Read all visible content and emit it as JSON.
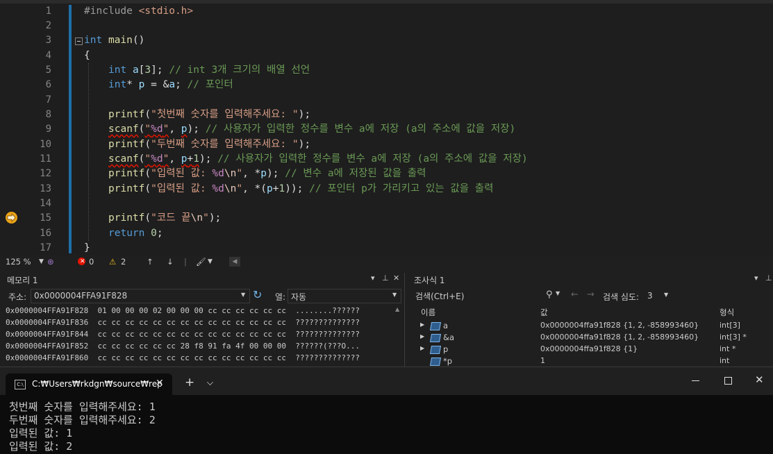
{
  "editor": {
    "line_numbers": [
      "1",
      "2",
      "3",
      "4",
      "5",
      "6",
      "7",
      "8",
      "9",
      "10",
      "11",
      "12",
      "13",
      "14",
      "15",
      "16",
      "17"
    ],
    "zoom": "125 %",
    "errors": "0",
    "warnings": "2"
  },
  "memory": {
    "title": "메모리 1",
    "address_label": "주소:",
    "address_value": "0x0000004FFA91F828",
    "columns_label": "열:",
    "columns_value": "자동",
    "rows": [
      {
        "addr": "0x0000004FFA91F828",
        "bytes": "01 00 00 00 02 00 00 00 cc cc cc cc cc cc",
        "ascii": "........??????"
      },
      {
        "addr": "0x0000004FFA91F836",
        "bytes": "cc cc cc cc cc cc cc cc cc cc cc cc cc cc",
        "ascii": "??????????????"
      },
      {
        "addr": "0x0000004FFA91F844",
        "bytes": "cc cc cc cc cc cc cc cc cc cc cc cc cc cc",
        "ascii": "??????????????"
      },
      {
        "addr": "0x0000004FFA91F852",
        "bytes": "cc cc cc cc cc cc 28 f8 91 fa 4f 00 00 00",
        "ascii": "??????(???O..."
      },
      {
        "addr": "0x0000004FFA91F860",
        "bytes": "cc cc cc cc cc cc cc cc cc cc cc cc cc cc",
        "ascii": "??????????????"
      }
    ]
  },
  "watch": {
    "title": "조사식 1",
    "search_placeholder": "검색(Ctrl+E)",
    "depth_label": "검색 심도:",
    "depth_value": "3",
    "col_name": "이름",
    "col_value": "값",
    "col_type": "형식",
    "rows": [
      {
        "name": "a",
        "value": "0x0000004ffa91f828 {1, 2, -858993460}",
        "type": "int[3]"
      },
      {
        "name": "&a",
        "value": "0x0000004ffa91f828 {1, 2, -858993460}",
        "type": "int[3] *"
      },
      {
        "name": "p",
        "value": "0x0000004ffa91f828 {1}",
        "type": "int *"
      },
      {
        "name": "*p",
        "value": "1",
        "type": "int"
      }
    ]
  },
  "terminal": {
    "tab_title": "C:₩Users₩rkdgn₩source₩rep",
    "lines": [
      "첫번째 숫자를 입력해주세요: 1",
      "두번째 숫자를 입력해주세요: 2",
      "입력된 값: 1",
      "입력된 값: 2"
    ]
  },
  "colors": {
    "keyword": "#569cd6",
    "function": "#dcdcaa",
    "string": "#d69d85",
    "comment": "#6a9955",
    "accent": "#1f6fa8",
    "breakpoint": "#e8a317",
    "error": "#e51400"
  }
}
